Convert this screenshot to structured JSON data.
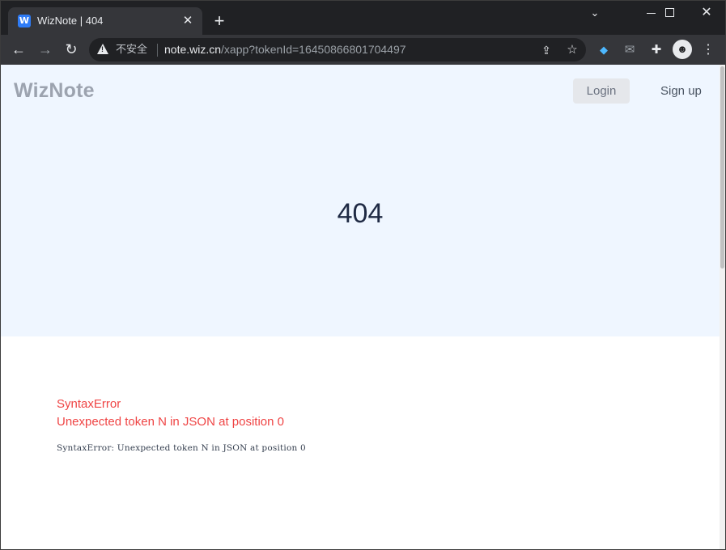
{
  "browser": {
    "tab": {
      "favicon_letter": "W",
      "title": "WizNote | 404",
      "close_glyph": "✕"
    },
    "new_tab_glyph": "+",
    "window_controls": {
      "chevron_glyph": "⌄",
      "close_glyph": "✕"
    },
    "nav": {
      "back_glyph": "←",
      "forward_glyph": "→",
      "reload_glyph": "↻"
    },
    "omnibox": {
      "security_label": "不安全",
      "url_host": "note.wiz.cn",
      "url_path": "/xapp?tokenId=16450866801704497"
    },
    "extension_icons": [
      "share-icon",
      "star-icon",
      "gem-icon",
      "mail-icon",
      "puzzle-icon",
      "profile-icon",
      "menu-icon"
    ]
  },
  "page": {
    "logo": "WizNote",
    "login_label": "Login",
    "signup_label": "Sign up",
    "status_code": "404",
    "error": {
      "name": "SyntaxError",
      "message": "Unexpected token N in JSON at position 0",
      "stack": "SyntaxError: Unexpected token N in JSON at position 0"
    }
  },
  "colors": {
    "hero_bg": "#eff6ff",
    "error_text": "#ef4444",
    "chrome_dark": "#202124",
    "chrome_toolbar": "#35363a"
  }
}
